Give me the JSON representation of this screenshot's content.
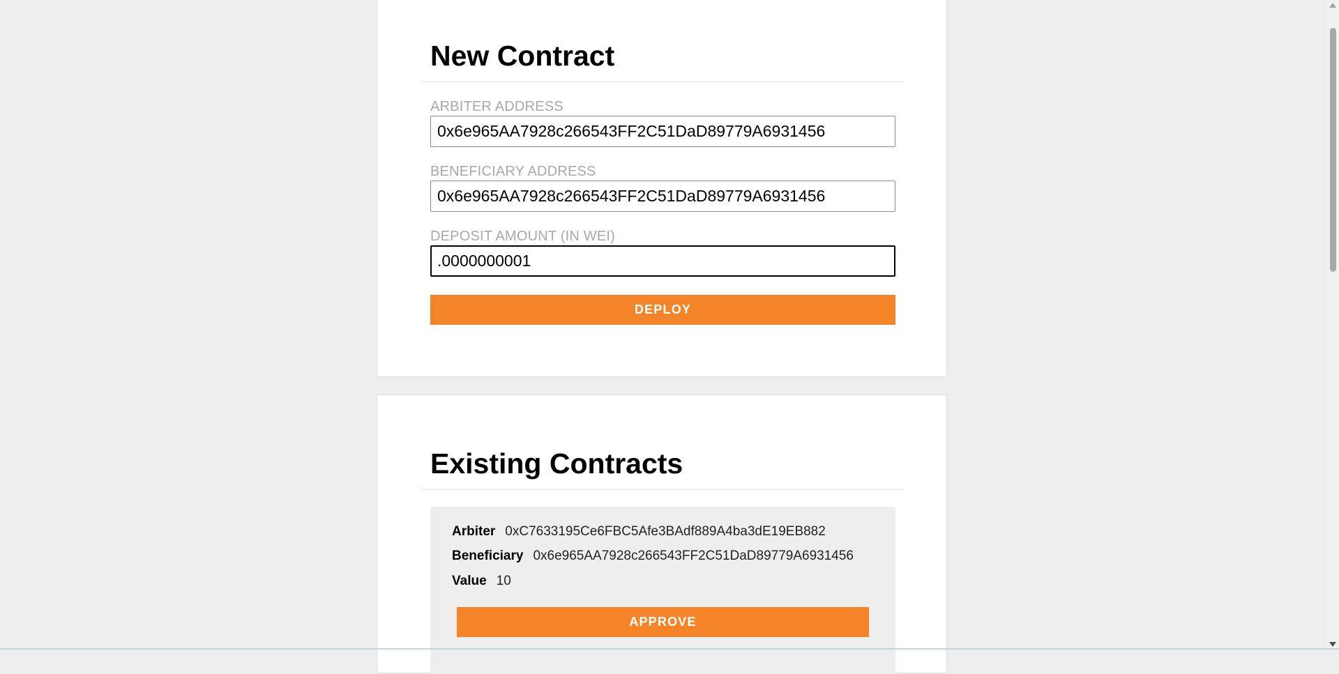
{
  "new_contract": {
    "title": "New Contract",
    "arbiter_label": "ARBITER ADDRESS",
    "arbiter_value": "0x6e965AA7928c266543FF2C51DaD89779A6931456",
    "beneficiary_label": "BENEFICIARY ADDRESS",
    "beneficiary_value": "0x6e965AA7928c266543FF2C51DaD89779A6931456",
    "deposit_label": "DEPOSIT AMOUNT (IN WEI)",
    "deposit_value": ".0000000001",
    "deploy_label": "DEPLOY"
  },
  "existing_contracts": {
    "title": "Existing Contracts",
    "contracts": [
      {
        "arbiter_key": "Arbiter",
        "arbiter": "0xC7633195Ce6FBC5Afe3BAdf889A4ba3dE19EB882",
        "beneficiary_key": "Beneficiary",
        "beneficiary": "0x6e965AA7928c266543FF2C51DaD89779A6931456",
        "value_key": "Value",
        "value": "10",
        "approve_label": "APPROVE"
      }
    ]
  },
  "colors": {
    "accent": "#f58428",
    "page_background": "#eeeeee",
    "card_background": "#ffffff",
    "label_text": "#a8a8a8"
  }
}
